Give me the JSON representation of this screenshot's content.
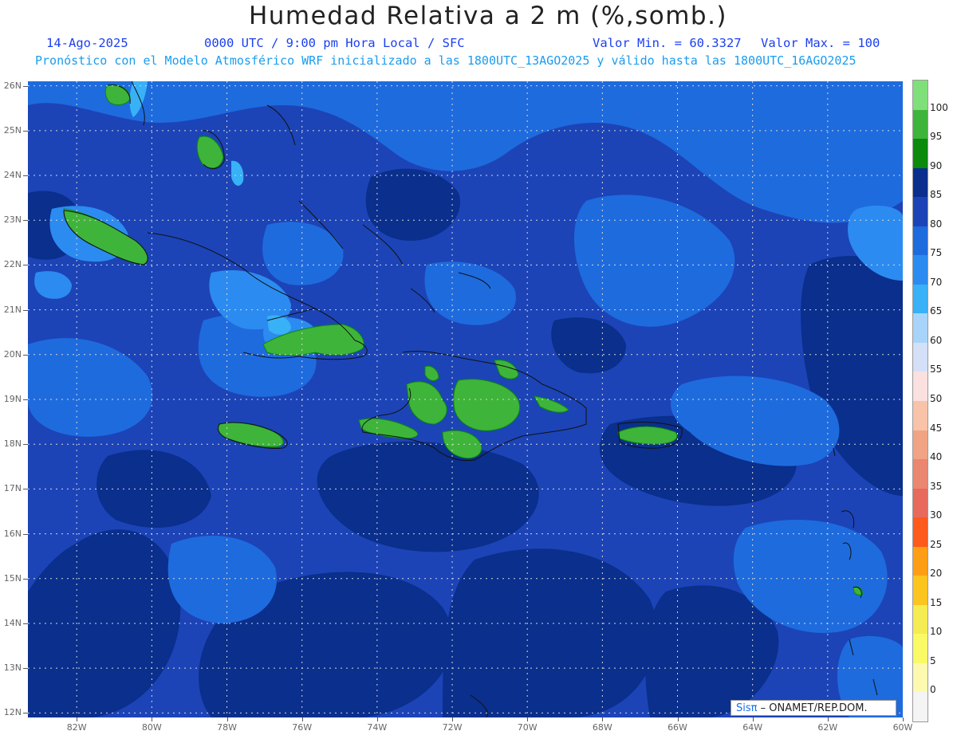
{
  "header": {
    "title": "Humedad Relativa a 2 m (%,somb.)",
    "date": "14-Ago-2025",
    "time_info": "0000 UTC / 9:00 pm Hora Local / SFC",
    "min_label": "Valor Min. = 60.3327",
    "max_label": "Valor Max. = 100",
    "forecast_info": "Pronóstico con el Modelo Atmosférico WRF inicializado a las 1800UTC_13AGO2025 y válido hasta las  1800UTC_16AGO2025"
  },
  "axes": {
    "lat_labels": [
      "26N",
      "25N",
      "24N",
      "23N",
      "22N",
      "21N",
      "20N",
      "19N",
      "18N",
      "17N",
      "16N",
      "15N",
      "14N",
      "13N",
      "12N"
    ],
    "lon_labels": [
      "82W",
      "80W",
      "78W",
      "76W",
      "74W",
      "72W",
      "70W",
      "68W",
      "66W",
      "64W",
      "62W",
      "60W"
    ]
  },
  "map_extent": {
    "lon_min": -83.3,
    "lon_max": -60.0,
    "lat_min": 11.9,
    "lat_max": 26.1
  },
  "legend": {
    "labels": [
      "100",
      "95",
      "90",
      "85",
      "80",
      "75",
      "70",
      "65",
      "60",
      "55",
      "50",
      "45",
      "40",
      "35",
      "30",
      "25",
      "20",
      "15",
      "10",
      "5",
      "0"
    ],
    "colors": [
      "#7fe07a",
      "#3fb43a",
      "#0b8a0b",
      "#0a2f8c",
      "#1c44b7",
      "#1e6bde",
      "#2c8bf0",
      "#38b1f7",
      "#a8d4fa",
      "#d4e0f8",
      "#fbe0e0",
      "#f8c3a8",
      "#f1a484",
      "#eb8670",
      "#e86a5c",
      "#fd5a1c",
      "#fe9e14",
      "#fcc41e",
      "#f4ec52",
      "#fafa66",
      "#fdfab0",
      "#f4f4f4"
    ]
  },
  "credit": {
    "brand": "Sisπ",
    "org": "– ONAMET/REP.DOM."
  },
  "colors": {
    "rh_80_85": "#1c44b7",
    "rh_85_90": "#0a2f8c",
    "rh_75_80": "#1e6bde",
    "rh_70_75": "#2c8bf0",
    "rh_65_70": "#38b1f7",
    "rh_90_95": "#3fb43a",
    "rh_95_100": "#0b8a0b",
    "title_blue": "#1c3ff0",
    "subtitle_cyan": "#1a9cf0"
  }
}
